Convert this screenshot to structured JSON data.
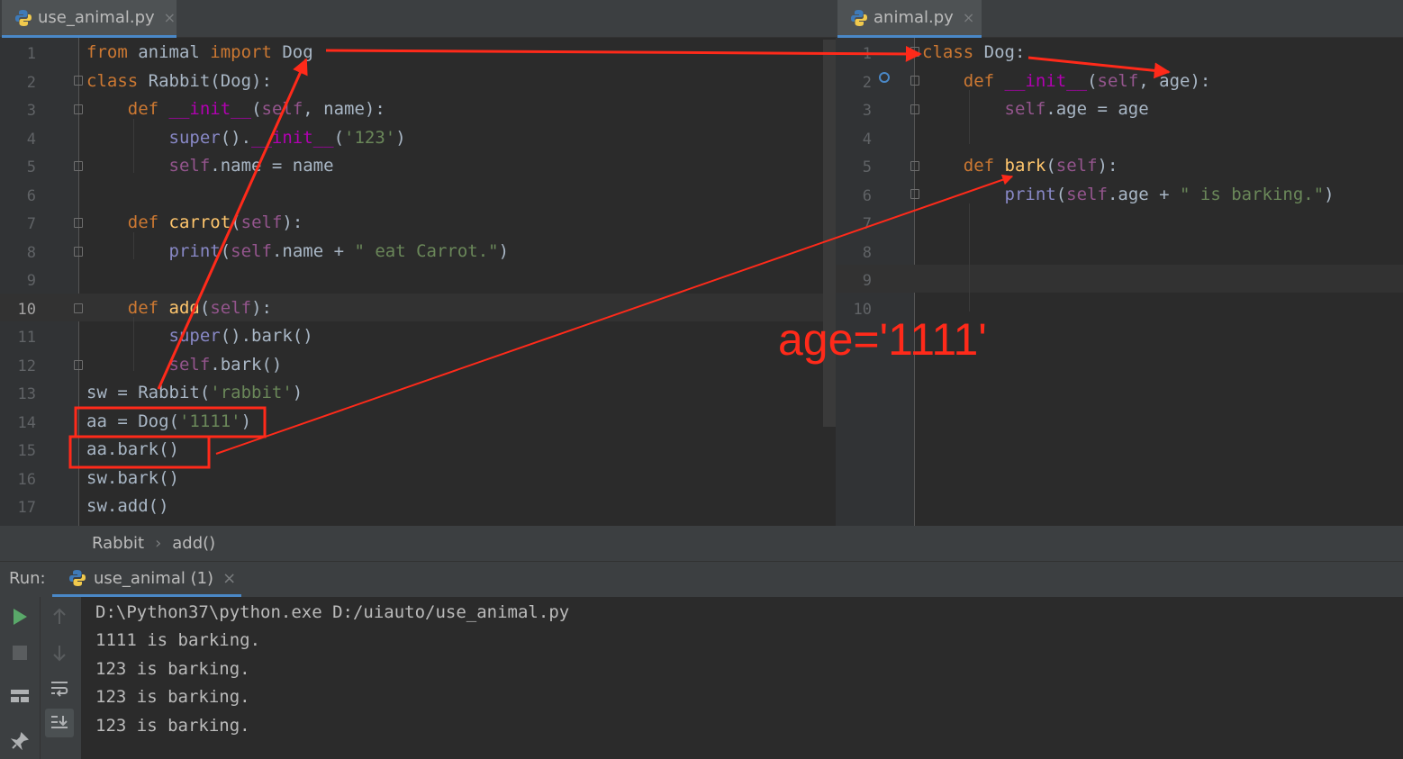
{
  "left_tab": {
    "label": "use_animal.py",
    "close": "×"
  },
  "right_tab": {
    "label": "animal.py",
    "close": "×"
  },
  "left_editor": {
    "line_numbers": [
      "1",
      "2",
      "3",
      "4",
      "5",
      "6",
      "7",
      "8",
      "9",
      "10",
      "11",
      "12",
      "13",
      "14",
      "15",
      "16",
      "17"
    ],
    "current_line": "10"
  },
  "right_editor": {
    "line_numbers": [
      "1",
      "2",
      "3",
      "4",
      "5",
      "6",
      "7",
      "8",
      "9",
      "10"
    ]
  },
  "annotation": {
    "text": "age='1111'",
    "color": "#ff2a1a"
  },
  "breadcrumb": {
    "items": [
      "Rabbit",
      "add()"
    ],
    "separator": "›"
  },
  "run": {
    "label": "Run:",
    "tab_label": "use_animal (1)",
    "close": "×",
    "output": [
      "D:\\Python37\\python.exe D:/uiauto/use_animal.py",
      "1111 is barking.",
      "123 is barking.",
      "123 is barking.",
      "123 is barking."
    ]
  },
  "colors": {
    "keyword": "#cc7832",
    "self": "#94558d",
    "string": "#6a8759",
    "magic": "#b200b2",
    "function": "#ffc66d",
    "builtin": "#8888c6",
    "text": "#a9b7c6"
  }
}
